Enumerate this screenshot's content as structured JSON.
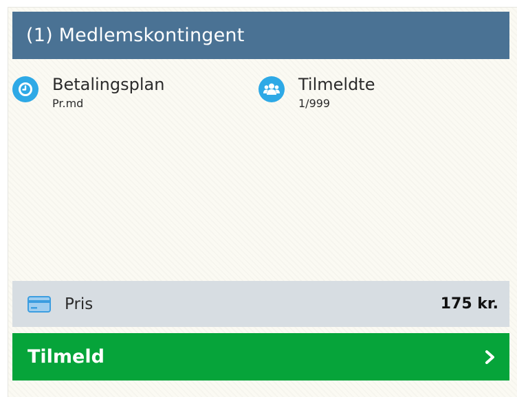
{
  "header": {
    "title": "(1) Medlemskontingent"
  },
  "info": {
    "payment_plan": {
      "icon": "clock-icon",
      "label": "Betalingsplan",
      "value": "Pr.md"
    },
    "registered": {
      "icon": "users-icon",
      "label": "Tilmeldte",
      "value": "1/999"
    }
  },
  "price": {
    "icon": "credit-card-icon",
    "label": "Pris",
    "value": "175 kr."
  },
  "signup": {
    "label": "Tilmeld",
    "icon": "chevron-right-icon"
  },
  "colors": {
    "header_bg": "#4a7294",
    "icon_blue": "#2ea9e6",
    "price_bg": "#d7dde2",
    "button_green": "#06a43a"
  }
}
